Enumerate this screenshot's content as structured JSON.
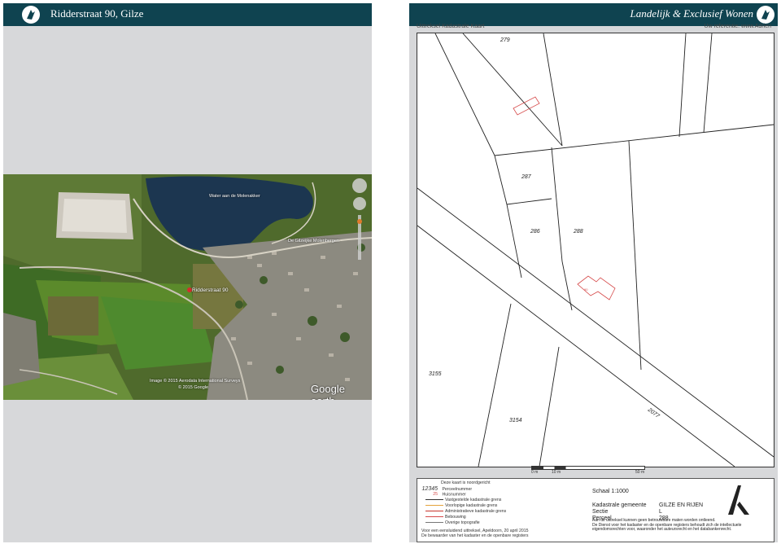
{
  "left_page": {
    "title": "Ridderstraat 90, Gilze",
    "aerial": {
      "labels": {
        "lake": "Water aan de Molenakker",
        "place": "De Gilzeijke Molenbergen",
        "address": "Ridderstraat 90",
        "credit_line1": "Image © 2015 Aerodata International Surveys",
        "credit_line2": "© 2015 Google",
        "brand": "Google earth"
      }
    }
  },
  "right_page": {
    "title": "Landelijk & Exclusief Wonen",
    "cut_left": "Uittreksel Kadastrale Kaart",
    "cut_right": "Uw referentie: www.Adrien",
    "parcels": [
      "279",
      "287",
      "286",
      "288",
      "3155",
      "3154",
      "2077"
    ],
    "building_numbers": [
      "90"
    ],
    "scale": {
      "start": "0 m",
      "mid": "10 m",
      "end": "50 m"
    },
    "legend": {
      "north_note": "Deze kaart is noordgericht",
      "items": [
        {
          "symbol": "12345",
          "label": "Perceelnummer"
        },
        {
          "symbol": "25",
          "label": "Huisnummer"
        },
        {
          "symbol": "",
          "label": "Vastgestelde kadastrale grens",
          "color": "#333333"
        },
        {
          "symbol": "",
          "label": "Voorlopige kadastrale grens",
          "color": "#e3a33b"
        },
        {
          "symbol": "",
          "label": "Administratieve kadastrale grens",
          "color": "#c7352c"
        },
        {
          "symbol": "",
          "label": "Bebouwing",
          "color": "#d64a4a"
        },
        {
          "symbol": "",
          "label": "Overige topografie",
          "color": "#777777"
        }
      ],
      "footer1": "Voor een eensluidend uittreksel, Apeldoorn, 20 april 2015",
      "footer2": "De bewaarder van het kadaster en de openbare registers"
    },
    "kadaster": {
      "scale": "Schaal 1:1000",
      "gemeente_label": "Kadastrale gemeente",
      "gemeente_value": "GILZE EN RIJEN",
      "sectie_label": "Sectie",
      "sectie_value": "L",
      "perceel_label": "Perceel",
      "perceel_value": "288",
      "note1": "Aan dit uittreksel kunnen geen betrouwbare maten worden ontleend.",
      "note2": "De Dienst voor het kadaster en de openbare registers behoudt zich de intellectuele",
      "note3": "eigendomsrechten voor, waaronder het auteursrecht en het databankenrecht."
    }
  }
}
